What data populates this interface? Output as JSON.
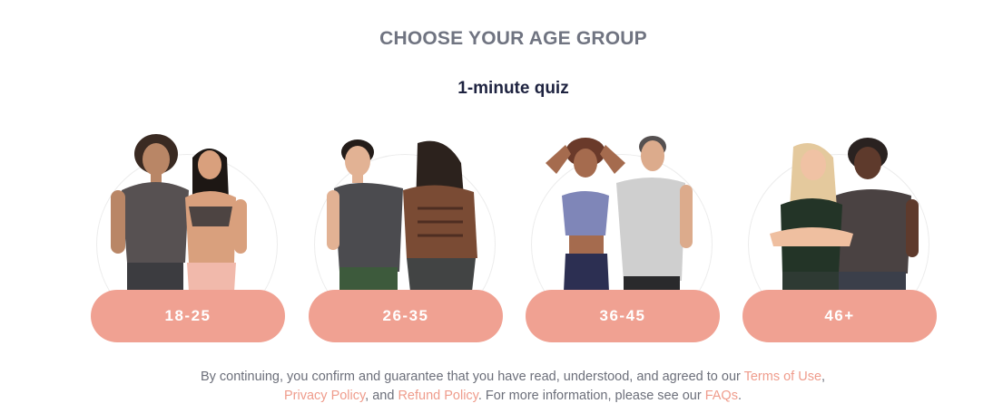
{
  "header": {
    "title": "CHOOSE YOUR AGE GROUP",
    "subtitle": "1-minute quiz"
  },
  "age_groups": [
    {
      "label": "18-25"
    },
    {
      "label": "26-35"
    },
    {
      "label": "36-45"
    },
    {
      "label": "46+"
    }
  ],
  "legal": {
    "text_1": "By continuing, you confirm and guarantee that you have read, understood, and agreed to our ",
    "terms_link": "Terms of Use",
    "sep_1": ", ",
    "privacy_link": "Privacy Policy",
    "sep_2": ", and ",
    "refund_link": "Refund Policy",
    "text_2": ". For more information, please see our ",
    "faqs_link": "FAQs",
    "text_3": "."
  },
  "colors": {
    "accent": "#f0a192",
    "title_gray": "#707481",
    "subtitle_navy": "#1e2340",
    "link": "#ef9c8c"
  }
}
